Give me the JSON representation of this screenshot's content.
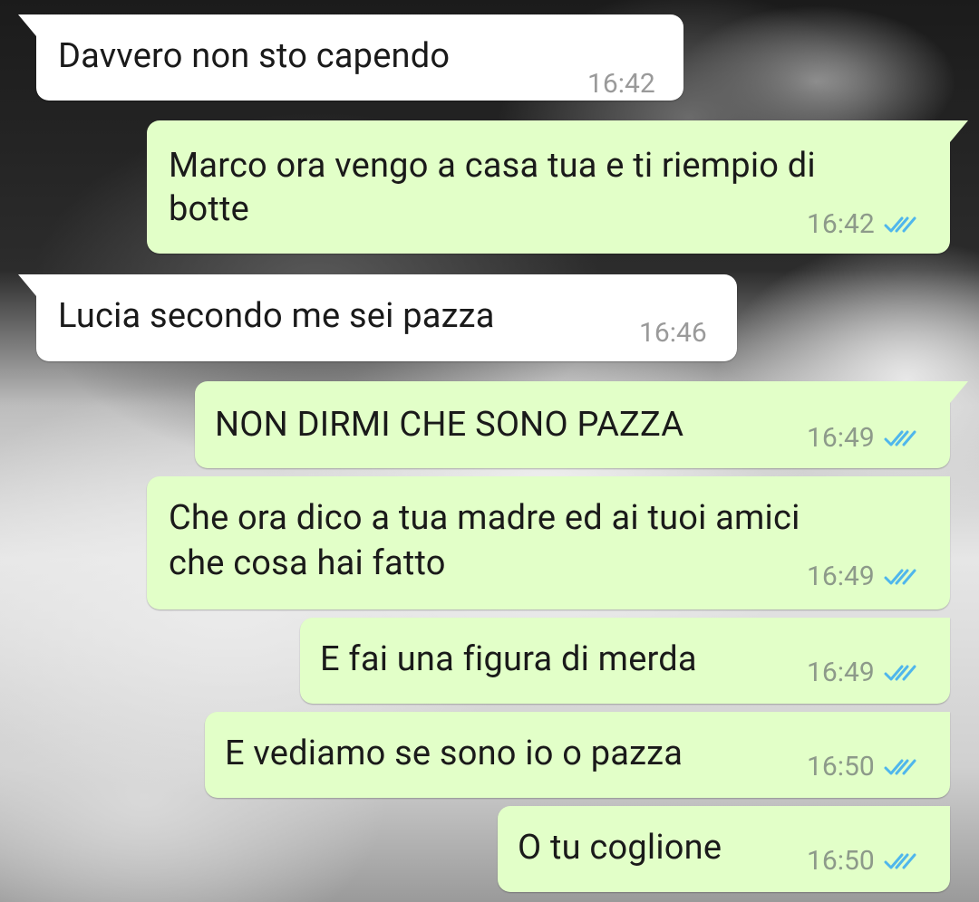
{
  "messages": [
    {
      "direction": "in",
      "text": "Davvero non sto capendo",
      "time": "16:42"
    },
    {
      "direction": "out",
      "text_lines": [
        "Marco ora vengo a casa tua e ti riempio di",
        "botte"
      ],
      "time": "16:42",
      "status": "read-double-check-icon"
    },
    {
      "direction": "in",
      "text": "Lucia secondo me sei pazza",
      "time": "16:46"
    },
    {
      "direction": "out",
      "text": "NON DIRMI CHE SONO PAZZA",
      "time": "16:49",
      "status": "read-double-check-icon"
    },
    {
      "direction": "out",
      "text_lines": [
        "Che ora dico a tua madre ed ai tuoi amici",
        "che cosa hai fatto"
      ],
      "time": "16:49",
      "status": "read-double-check-icon"
    },
    {
      "direction": "out",
      "text": "E fai una figura di merda",
      "time": "16:49",
      "status": "read-double-check-icon"
    },
    {
      "direction": "out",
      "text": "E vediamo se sono io o pazza",
      "time": "16:50",
      "status": "read-double-check-icon"
    },
    {
      "direction": "out",
      "text": "O tu coglione",
      "time": "16:50",
      "status": "read-double-check-icon"
    }
  ],
  "colors": {
    "incoming_bubble": "#ffffff",
    "outgoing_bubble": "#e2ffc8",
    "read_tick": "#4fb6ec",
    "timestamp": "#8d9a8a"
  }
}
